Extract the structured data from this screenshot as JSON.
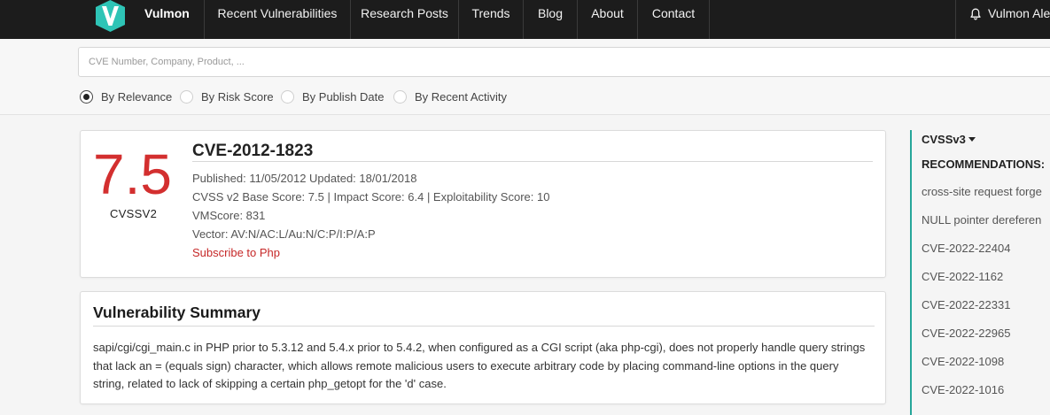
{
  "nav": {
    "brand": "Vulmon",
    "items": [
      {
        "label": "Recent Vulnerabilities"
      },
      {
        "label": "Research Posts"
      },
      {
        "label": "Trends"
      },
      {
        "label": "Blog"
      },
      {
        "label": "About"
      },
      {
        "label": "Contact"
      }
    ],
    "user_label": "Vulmon Ale",
    "bell_icon": "bell-icon",
    "logo_icon": "vulmon-logo-icon",
    "colors": {
      "bar": "#1c1c1c",
      "logo": "#2ec4b6"
    }
  },
  "search": {
    "placeholder": "CVE Number, Company, Product, ...",
    "value": "",
    "sort_options": [
      {
        "label": "By Relevance",
        "checked": true
      },
      {
        "label": "By Risk Score",
        "checked": false
      },
      {
        "label": "By Publish Date",
        "checked": false
      },
      {
        "label": "By Recent Activity",
        "checked": false
      }
    ]
  },
  "cve": {
    "score": "7.5",
    "score_label": "CVSSV2",
    "score_color": "#d32f2f",
    "id": "CVE-2012-1823",
    "published_line": "Published: 11/05/2012 Updated: 18/01/2018",
    "cvss_line": "CVSS v2 Base Score: 7.5 | Impact Score: 6.4 | Exploitability Score: 10",
    "vmscore_line": "VMScore: 831",
    "vector_line": "Vector: AV:N/AC:L/Au:N/C:P/I:P/A:P",
    "subscribe": "Subscribe to Php"
  },
  "summary": {
    "title": "Vulnerability Summary",
    "text": "sapi/cgi/cgi_main.c in PHP prior to 5.3.12 and 5.4.x prior to 5.4.2, when configured as a CGI script (aka php-cgi), does not properly handle query strings that lack an = (equals sign) character, which allows remote malicious users to execute arbitrary code by placing command-line options in the query string, related to lack of skipping a certain php_getopt for the 'd' case."
  },
  "sidebar": {
    "cvss_toggle": "CVSSv3",
    "recommendations_heading": "RECOMMENDATIONS:",
    "accent_color": "#26a69a",
    "items": [
      {
        "label": "cross-site request forge"
      },
      {
        "label": "NULL pointer dereferen"
      },
      {
        "label": "CVE-2022-22404"
      },
      {
        "label": "CVE-2022-1162"
      },
      {
        "label": "CVE-2022-22331"
      },
      {
        "label": "CVE-2022-22965"
      },
      {
        "label": "CVE-2022-1098"
      },
      {
        "label": "CVE-2022-1016"
      }
    ]
  }
}
